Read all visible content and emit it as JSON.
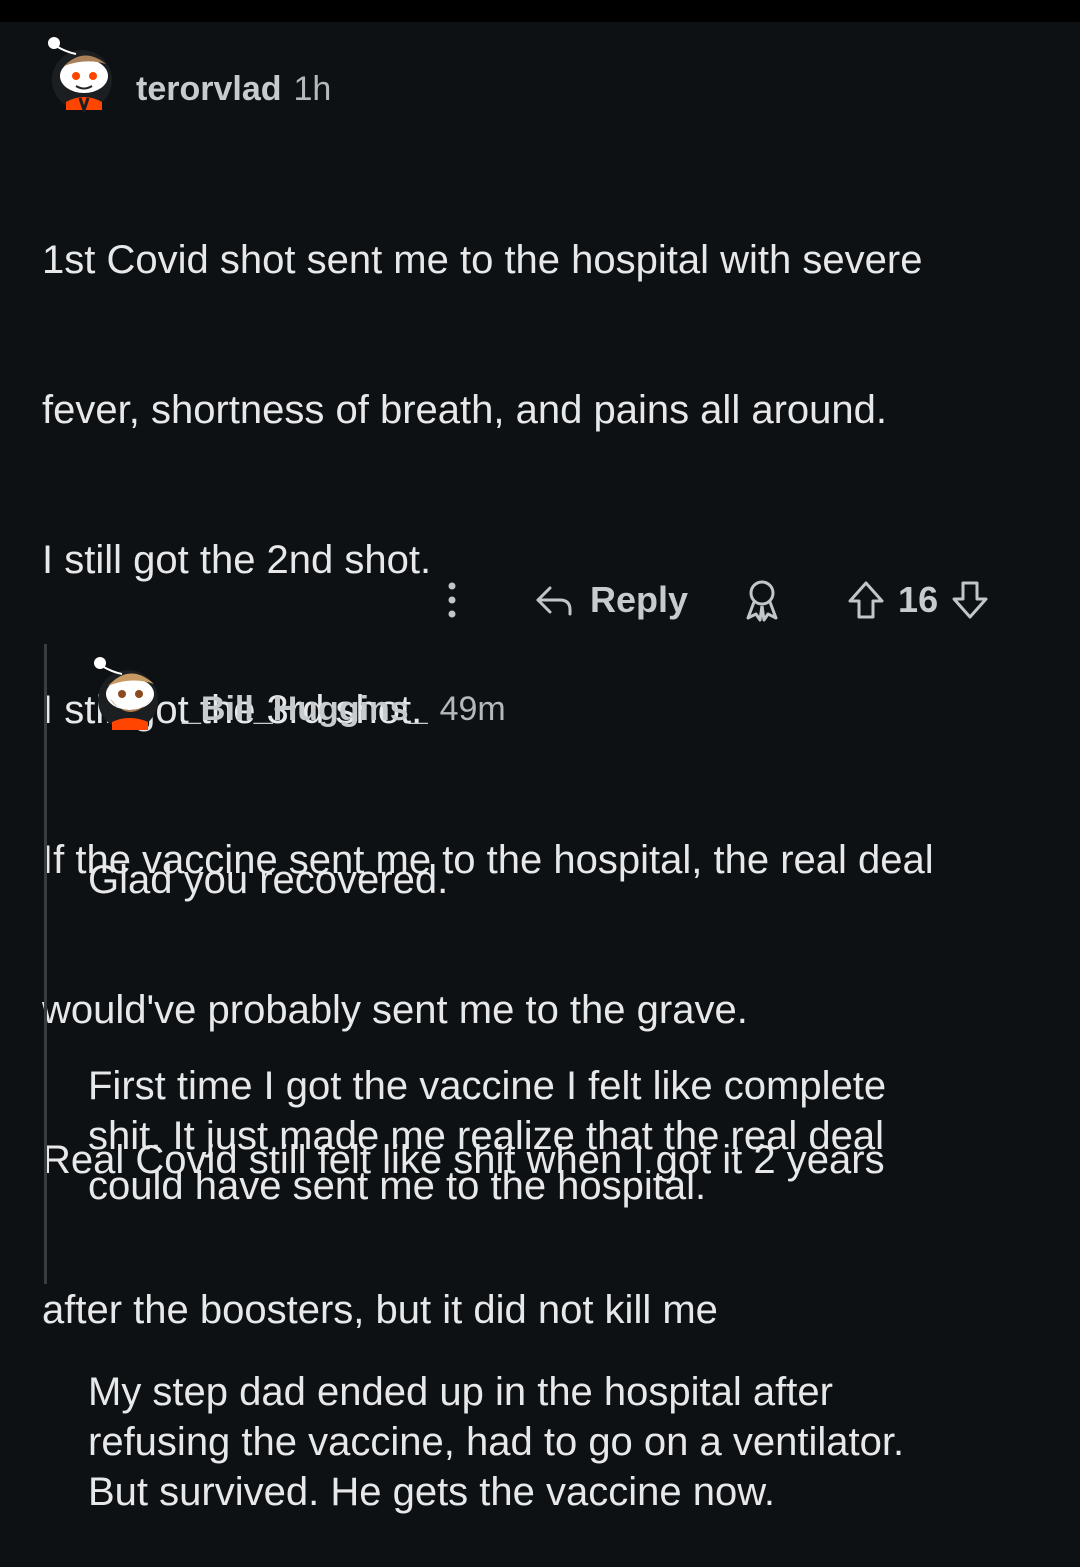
{
  "comments": [
    {
      "username": "terorvlad",
      "time": "1h",
      "avatar_icon": "snoo-avatar-icon",
      "lines": [
        "1st Covid shot sent me to the hospital with severe",
        "fever, shortness of breath, and pains all around.",
        "I still got the 2nd shot.",
        "I still got the 3rd shot.",
        "If the vaccine sent me to the hospital, the real deal",
        "would've probably sent me to the grave.",
        "Real Covid still felt like shit when I got it 2 years",
        "after the boosters, but it did not kill me"
      ],
      "actions": {
        "more_icon": "more-vertical-icon",
        "reply_icon": "reply-arrow-icon",
        "reply_label": "Reply",
        "award_icon": "award-icon",
        "upvote_icon": "upvote-icon",
        "score": "16",
        "downvote_icon": "downvote-icon"
      }
    },
    {
      "username": "_Bill_Huggins_",
      "time": "49m",
      "avatar_icon": "snoo-avatar-icon",
      "paragraphs": [
        "Glad you recovered.",
        "First time I got the vaccine I felt like complete\nshit. It just made me realize that the real deal\ncould have sent me to the hospital.",
        "My step dad ended up in the hospital after\nrefusing the vaccine, had to go on a ventilator.\nBut survived. He gets the vaccine now."
      ]
    }
  ],
  "colors": {
    "background": "#0e1113",
    "text": "#e6e8ea",
    "meta": "#b5b9bc",
    "avatar_accent": "#ff4500"
  }
}
